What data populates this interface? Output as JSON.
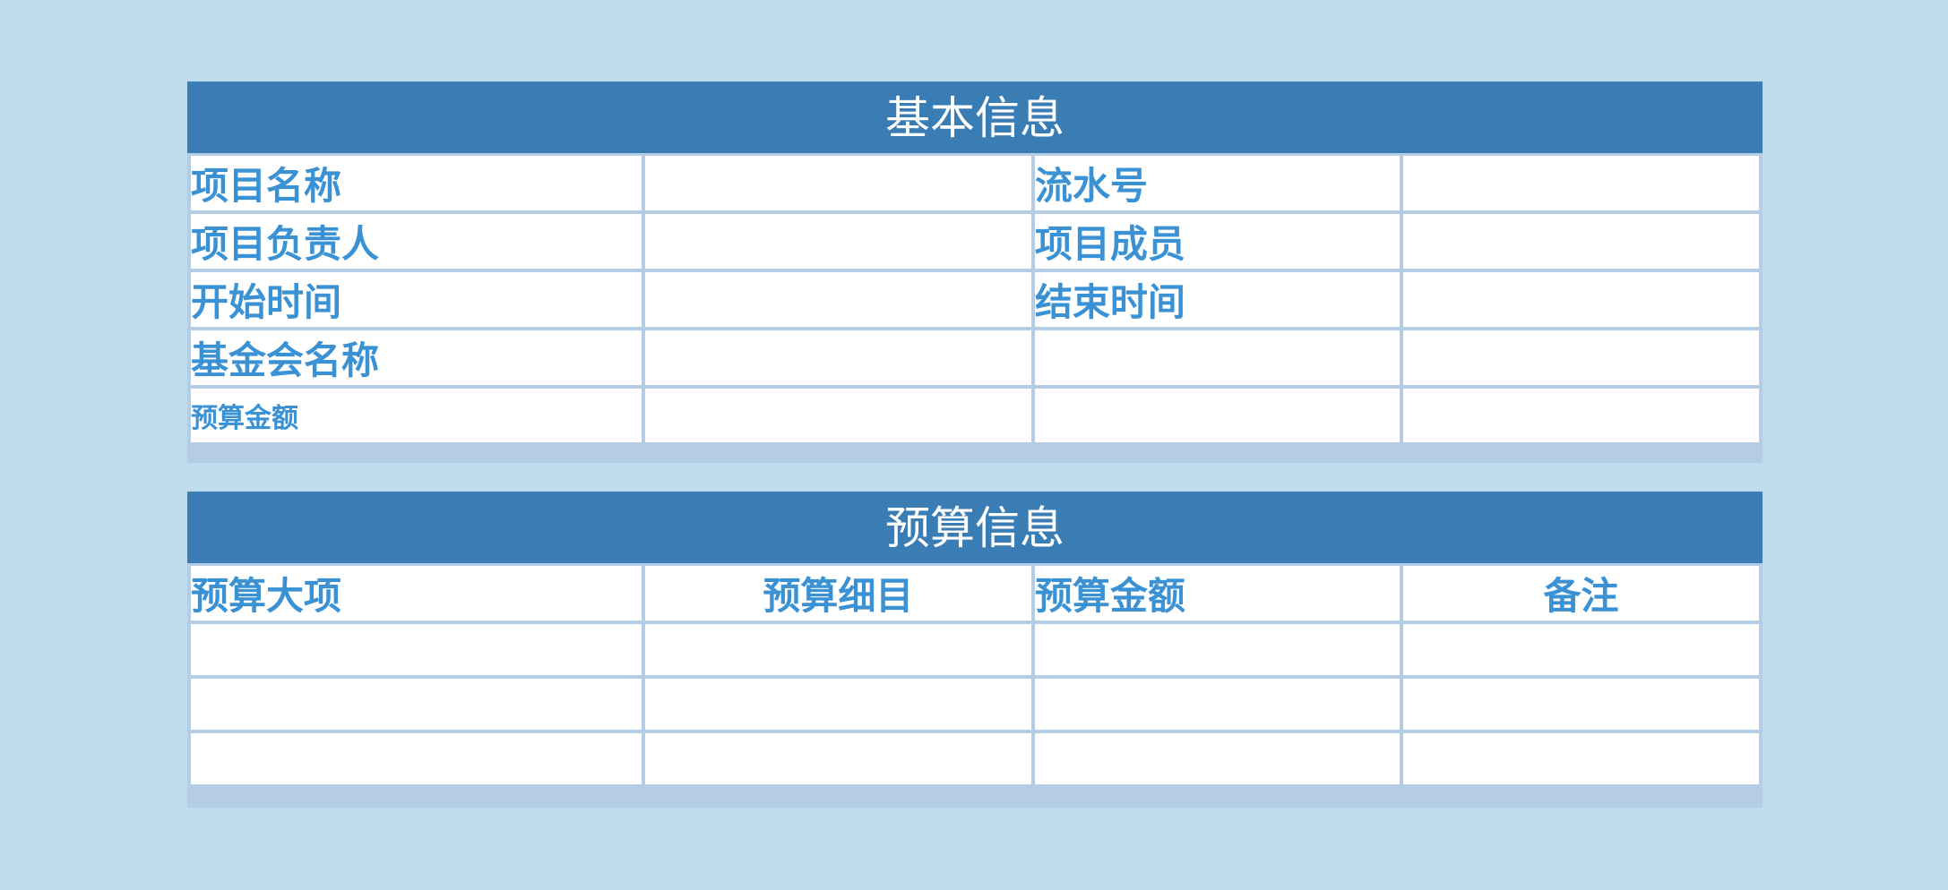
{
  "basic_info": {
    "title": "基本信息",
    "rows": [
      {
        "label_left": "项目名称",
        "value_left": "",
        "label_right": "流水号",
        "value_right": ""
      },
      {
        "label_left": "项目负责人",
        "value_left": "",
        "label_right": "项目成员",
        "value_right": ""
      },
      {
        "label_left": "开始时间",
        "value_left": "",
        "label_right": "结束时间",
        "value_right": ""
      },
      {
        "label_left": "基金会名称",
        "value_left": "",
        "label_right": "",
        "value_right": ""
      },
      {
        "label_left": "预算金额",
        "value_left": "",
        "label_right": "",
        "value_right": ""
      }
    ]
  },
  "budget_info": {
    "title": "预算信息",
    "headers": [
      "预算大项",
      "预算细目",
      "预算金额",
      "备注"
    ],
    "rows": [
      [
        "",
        "",
        "",
        ""
      ],
      [
        "",
        "",
        "",
        ""
      ],
      [
        "",
        "",
        "",
        ""
      ]
    ]
  }
}
